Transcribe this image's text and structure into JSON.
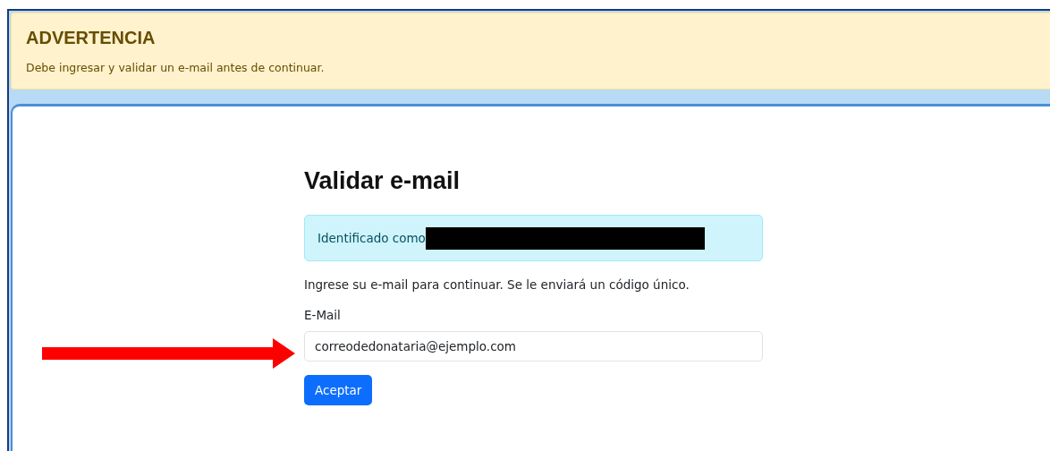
{
  "warning": {
    "title": "ADVERTENCIA",
    "message": "Debe ingresar y validar un e-mail antes de continuar."
  },
  "form": {
    "title": "Validar e-mail",
    "identity": {
      "label": "Identificado como",
      "redacted": true
    },
    "instructions": "Ingrese su e-mail para continuar. Se le enviará un código único.",
    "email_label": "E-Mail",
    "email_value": "correodedonataria@ejemplo.com",
    "submit": "Aceptar"
  },
  "annotations": [
    {
      "kind": "arrow",
      "color": "#ff0000"
    }
  ]
}
